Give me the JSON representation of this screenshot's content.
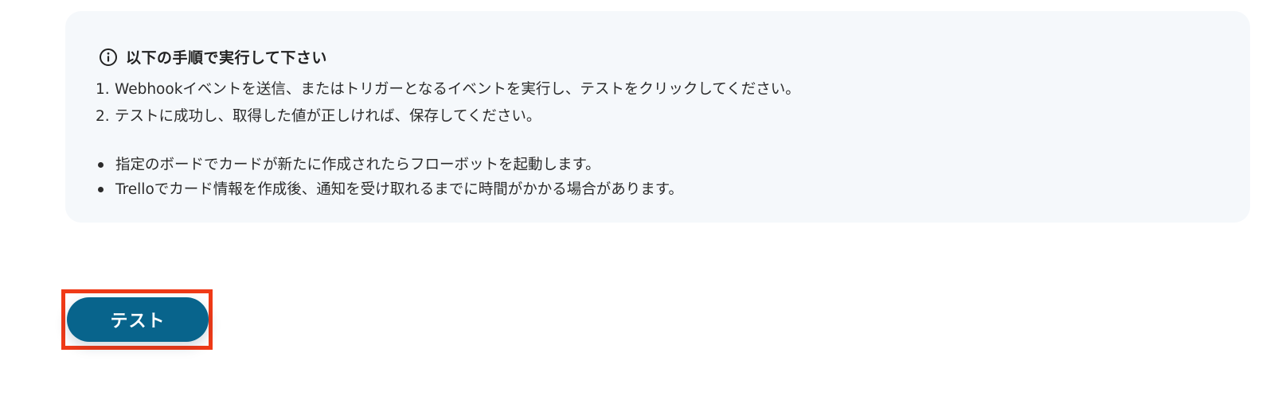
{
  "info": {
    "icon": "info-circle-icon",
    "title": "以下の手順で実行して下さい",
    "steps": [
      {
        "num": "1.",
        "text": "Webhookイベントを送信、またはトリガーとなるイベントを実行し、テストをクリックしてください。"
      },
      {
        "num": "2.",
        "text": "テストに成功し、取得した値が正しければ、保存してください。"
      }
    ],
    "notes": [
      "指定のボードでカードが新たに作成されたらフローボットを起動します。",
      "Trelloでカード情報を作成後、通知を受け取れるまでに時間がかかる場合があります。"
    ]
  },
  "actions": {
    "test_label": "テスト"
  },
  "colors": {
    "panel_bg": "#f5f8fb",
    "button_bg": "#08648c",
    "highlight_border": "#f03a17"
  }
}
